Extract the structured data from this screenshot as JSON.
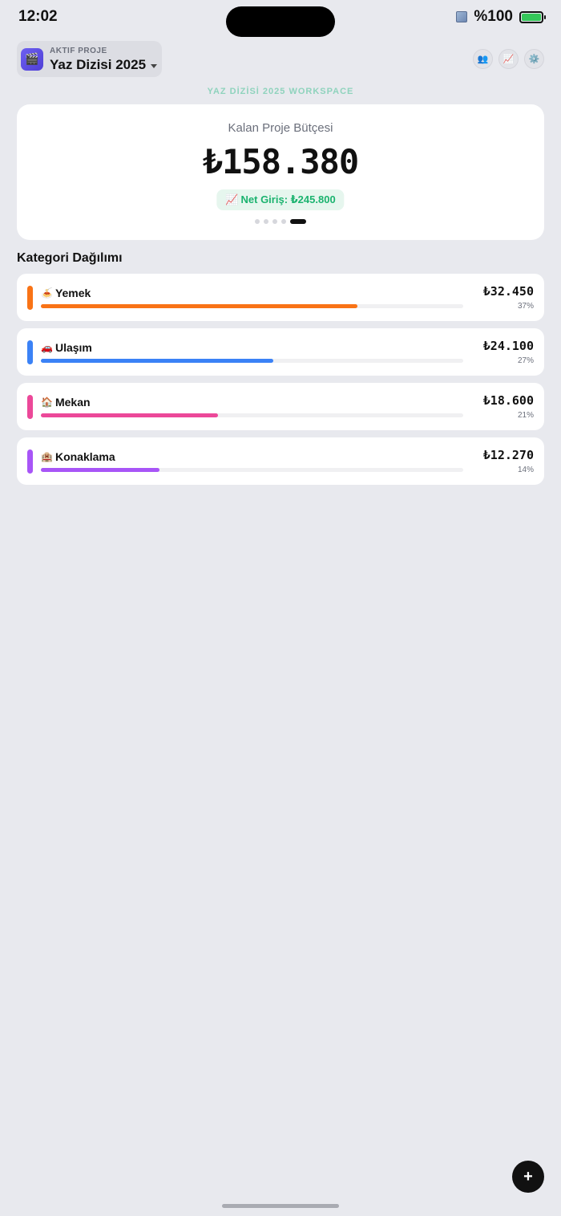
{
  "status_bar": {
    "time": "12:02",
    "battery": "%100"
  },
  "header": {
    "project_label": "AKTIF PROJE",
    "project_name": "Yaz Dizisi 2025",
    "project_icon": "🎬",
    "actions": [
      {
        "name": "team-icon",
        "glyph": "👥"
      },
      {
        "name": "chart-icon",
        "glyph": "📈"
      },
      {
        "name": "gear-icon",
        "glyph": "⚙️"
      }
    ]
  },
  "workspace_label": "YAZ DİZİSİ 2025 WORKSPACE",
  "budget": {
    "label": "Kalan Proje Bütçesi",
    "value": "₺158.380",
    "income_icon": "📈",
    "income_text": "Net Giriş: ₺245.800",
    "page_count": 5,
    "active_page": 4
  },
  "categories_title": "Kategori Dağılımı",
  "categories": [
    {
      "emoji": "🍝",
      "name": "Yemek",
      "amount": "₺32.450",
      "percent": "37%",
      "progress": 0.75,
      "color": "#f97316"
    },
    {
      "emoji": "🚗",
      "name": "Ulaşım",
      "amount": "₺24.100",
      "percent": "27%",
      "progress": 0.55,
      "color": "#3b82f6"
    },
    {
      "emoji": "🏠",
      "name": "Mekan",
      "amount": "₺18.600",
      "percent": "21%",
      "progress": 0.42,
      "color": "#ec4899"
    },
    {
      "emoji": "🏨",
      "name": "Konaklama",
      "amount": "₺12.270",
      "percent": "14%",
      "progress": 0.28,
      "color": "#a855f7"
    }
  ],
  "fab_label": "+"
}
